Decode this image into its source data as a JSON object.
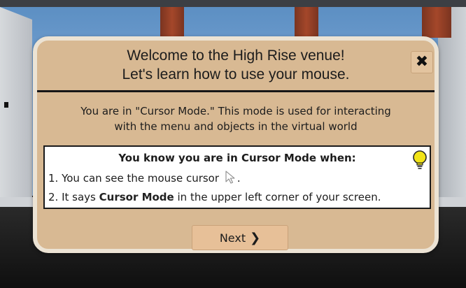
{
  "dialog": {
    "title_line1": "Welcome to the High Rise venue!",
    "title_line2": "Let's learn how to use your mouse.",
    "close_glyph": "✖",
    "description_line1": "You are in \"Cursor Mode.\" This mode is used for interacting",
    "description_line2": "with the menu and objects in the virtual world",
    "info": {
      "heading": "You know you are in Cursor Mode when:",
      "item1_text": "1. You can see the mouse cursor",
      "item1_suffix": ".",
      "item2_prefix": "2. It says",
      "item2_bold": "Cursor Mode",
      "item2_suffix": "in the upper left corner of your screen."
    },
    "next_label": "Next",
    "next_chevron": "❯"
  },
  "colors": {
    "dialog_bg": "#d8b993",
    "dialog_border": "#ece3d4",
    "button_bg": "#e7c098",
    "bulb": "#f2e417"
  },
  "icons": [
    "close-icon",
    "lightbulb-icon",
    "mouse-cursor-icon",
    "chevron-right-icon"
  ]
}
